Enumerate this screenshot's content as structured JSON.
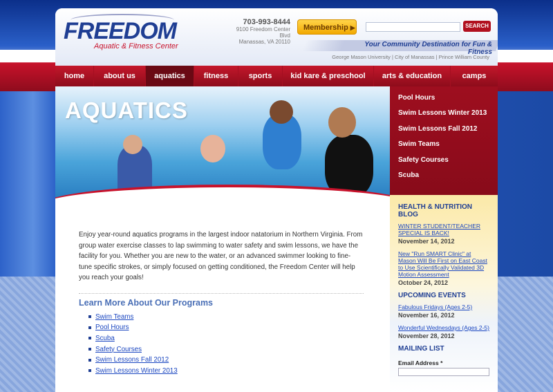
{
  "header": {
    "logo_main": "FREEDOM",
    "logo_sub": "Aquatic & Fitness Center",
    "phone": "703-993-8444",
    "address_line1": "9100 Freedom Center Blvd",
    "address_line2": "Manassas, VA 20110",
    "membership_label": "Membership",
    "search_placeholder": "",
    "search_label": "SEARCH",
    "tagline": "Your Community Destination for Fun & Fitness",
    "affiliations": "George Mason University | City of Manassas | Prince William County"
  },
  "nav": {
    "items": [
      {
        "label": "home"
      },
      {
        "label": "about us"
      },
      {
        "label": "aquatics"
      },
      {
        "label": "fitness"
      },
      {
        "label": "sports"
      },
      {
        "label": "kid kare & preschool"
      },
      {
        "label": "arts & education"
      },
      {
        "label": "camps"
      }
    ],
    "active": "aquatics"
  },
  "hero": {
    "title": "AQUATICS"
  },
  "sidebar": {
    "menu": [
      {
        "label": "Pool Hours"
      },
      {
        "label": "Swim Lessons Winter 2013"
      },
      {
        "label": "Swim Lessons Fall 2012"
      },
      {
        "label": "Swim Teams"
      },
      {
        "label": "Safety Courses"
      },
      {
        "label": "Scuba"
      }
    ],
    "blog": {
      "heading": "HEALTH & NUTRITION BLOG",
      "posts": [
        {
          "title": "WINTER STUDENT/TEACHER SPECIAL IS BACK!",
          "date": "November 14, 2012"
        },
        {
          "title": "New \"Run SMART Clinic\" at Mason Will Be First on East Coast to Use Scientifically Validated 3D Motion Assessment",
          "date": "October 24, 2012"
        }
      ]
    },
    "events": {
      "heading": "UPCOMING EVENTS",
      "items": [
        {
          "title": "Fabulous Fridays (Ages 2-5)",
          "date": "November 16, 2012"
        },
        {
          "title": "Wonderful Wednesdays (Ages 2-5)",
          "date": "November 28, 2012"
        }
      ]
    },
    "mailing": {
      "heading": "MAILING LIST",
      "email_label": "Email Address *"
    }
  },
  "content": {
    "intro": "Enjoy year-round aquatics programs in the largest indoor natatorium in Northern Virginia.  From group water exercise classes to lap swimming to water safety and swim lessons, we have the facility for you.  Whether you are new to the water, or an advanced swimmer looking to fine-tune specific strokes, or simply focused on getting conditioned, the Freedom Center will help you reach your goals!",
    "learn_heading": "Learn More About Our Programs",
    "programs": [
      {
        "label": "Swim Teams"
      },
      {
        "label": "Pool Hours"
      },
      {
        "label": "Scuba"
      },
      {
        "label": "Safety Courses"
      },
      {
        "label": "Swim Lessons Fall 2012"
      },
      {
        "label": "Swim Lessons Winter 2013"
      }
    ]
  },
  "colors": {
    "brand_blue": "#1f3e93",
    "brand_red": "#c8122b",
    "accent_gold": "#f2a900"
  }
}
